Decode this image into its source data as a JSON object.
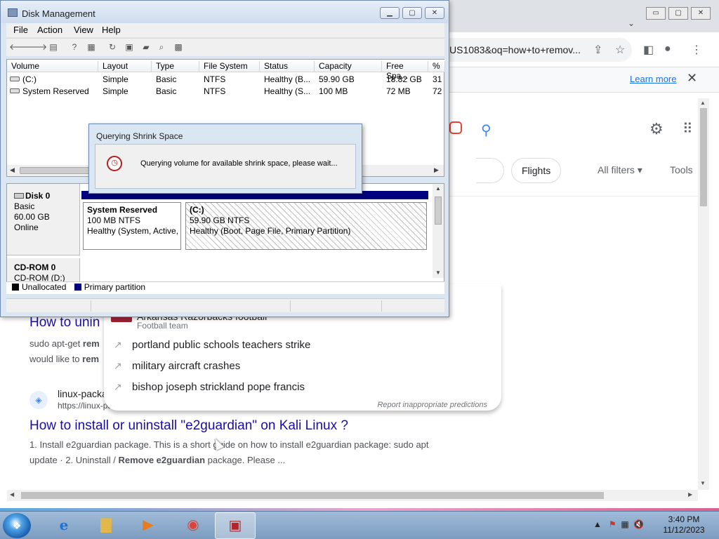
{
  "chrome": {
    "window_controls": [
      "▭",
      "▢",
      "✕"
    ],
    "omnibox_text": "US1083&oq=how+to+remov...",
    "learn_more": "Learn more",
    "infobar_close": "✕"
  },
  "google": {
    "chip_flights": "Flights",
    "all_filters": "All filters",
    "tools": "Tools",
    "suggestions": {
      "partial_entity": "Arkansas Razorbacks football",
      "partial_sub": "Football team",
      "items": [
        "portland public schools teachers strike",
        "military aircraft crashes",
        "bishop joseph strickland pope francis"
      ],
      "report": "Report inappropriate predictions"
    },
    "result1": {
      "title": "How to unin",
      "snippet_line1_a": "sudo apt-get ",
      "snippet_line1_b": "rem",
      "snippet_line2_a": "would like to ",
      "snippet_line2_b": "rem"
    },
    "result2": {
      "site": "linux-packa",
      "url": "https://linux-pa",
      "title": "How to install or uninstall \"e2guardian\" on Kali Linux ?",
      "snippet_a": "1. Install e2guardian package. This is a short guide on how to install e2guardian package: sudo apt update · 2. Uninstall / ",
      "snippet_b": "Remove e2guardian",
      "snippet_c": " package. Please ..."
    }
  },
  "disk_mgmt": {
    "title": "Disk Management",
    "menu": [
      "File",
      "Action",
      "View",
      "Help"
    ],
    "columns": [
      "Volume",
      "Layout",
      "Type",
      "File System",
      "Status",
      "Capacity",
      "Free Spa...",
      "% F"
    ],
    "rows": [
      [
        "(C:)",
        "Simple",
        "Basic",
        "NTFS",
        "Healthy (B...",
        "59.90 GB",
        "18.82 GB",
        "31"
      ],
      [
        "System Reserved",
        "Simple",
        "Basic",
        "NTFS",
        "Healthy (S...",
        "100 MB",
        "72 MB",
        "72"
      ]
    ],
    "disk0": {
      "name": "Disk 0",
      "type": "Basic",
      "size": "60.00 GB",
      "state": "Online"
    },
    "part_system": {
      "name": "System Reserved",
      "size": "100 MB NTFS",
      "status": "Healthy (System, Active,"
    },
    "part_c": {
      "name": "(C:)",
      "size": "59.90 GB NTFS",
      "status": "Healthy (Boot, Page File, Primary Partition)"
    },
    "cdrom": {
      "name": "CD-ROM 0",
      "drive": "CD-ROM (D:)"
    },
    "legend": {
      "unallocated": "Unallocated",
      "primary": "Primary partition"
    },
    "colors": {
      "unallocated": "#000000",
      "primary": "#00007f"
    }
  },
  "dialog": {
    "title": "Querying Shrink Space",
    "message": "Querying volume for available shrink space, please wait..."
  },
  "taskbar": {
    "time": "3:40 PM",
    "date": "11/12/2023"
  }
}
